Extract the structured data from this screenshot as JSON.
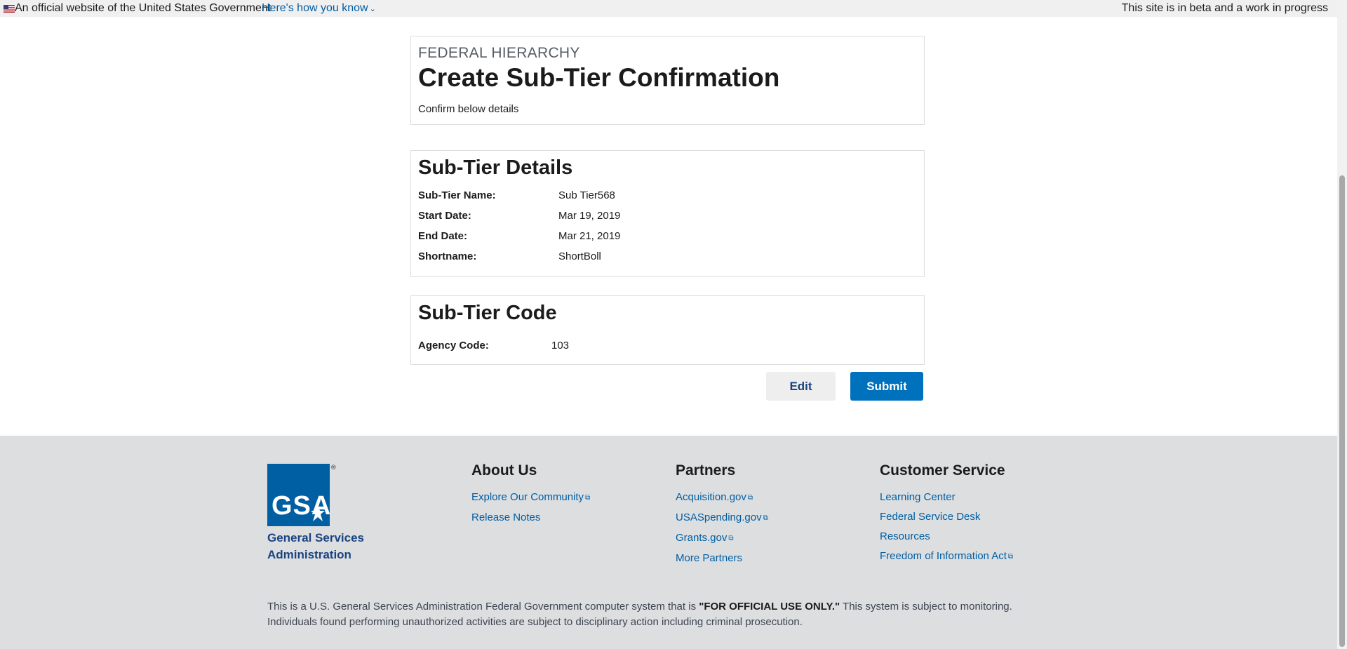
{
  "gov_banner": {
    "official_text": "An official website of the United States Government",
    "how_link": "Here's how you know",
    "beta_text": "This site is in beta and a work in progress"
  },
  "header": {
    "eyebrow": "FEDERAL HIERARCHY",
    "title": "Create Sub-Tier Confirmation",
    "subtitle": "Confirm below details"
  },
  "details": {
    "heading": "Sub-Tier Details",
    "rows": [
      {
        "label": "Sub-Tier Name:",
        "value": "Sub Tier568"
      },
      {
        "label": "Start Date:",
        "value": "Mar 19, 2019"
      },
      {
        "label": "End Date:",
        "value": "Mar 21, 2019"
      },
      {
        "label": "Shortname:",
        "value": "ShortBoll"
      }
    ]
  },
  "code": {
    "heading": "Sub-Tier Code",
    "agency_label": "Agency Code:",
    "agency_value": "103"
  },
  "actions": {
    "edit_label": "Edit",
    "submit_label": "Submit"
  },
  "footer": {
    "logo_text": "GSA",
    "logo_reg": "®",
    "org_name": "General Services Administration",
    "about": {
      "heading": "About Us",
      "links": [
        "Explore Our Community",
        "Release Notes"
      ]
    },
    "partners": {
      "heading": "Partners",
      "links": [
        "Acquisition.gov",
        "USASpending.gov",
        "Grants.gov",
        "More Partners"
      ]
    },
    "service": {
      "heading": "Customer Service",
      "links": [
        "Learning Center",
        "Federal Service Desk",
        "Resources",
        "Freedom of Information Act"
      ]
    },
    "disclaimer_pre": "This is a U.S. General Services Administration Federal Government computer system that is ",
    "disclaimer_bold": "\"FOR OFFICIAL USE ONLY.\"",
    "disclaimer_post": " This system is subject to monitoring. Individuals found performing unauthorized activities are subject to disciplinary action including criminal prosecution."
  },
  "colors": {
    "primary": "#0071bc",
    "link": "#005ea2",
    "footer_bg": "#dcdee0",
    "banner_bg": "#f0f0f0"
  },
  "icons": [
    "us-flag-icon",
    "chevron-down-icon",
    "external-link-icon"
  ]
}
